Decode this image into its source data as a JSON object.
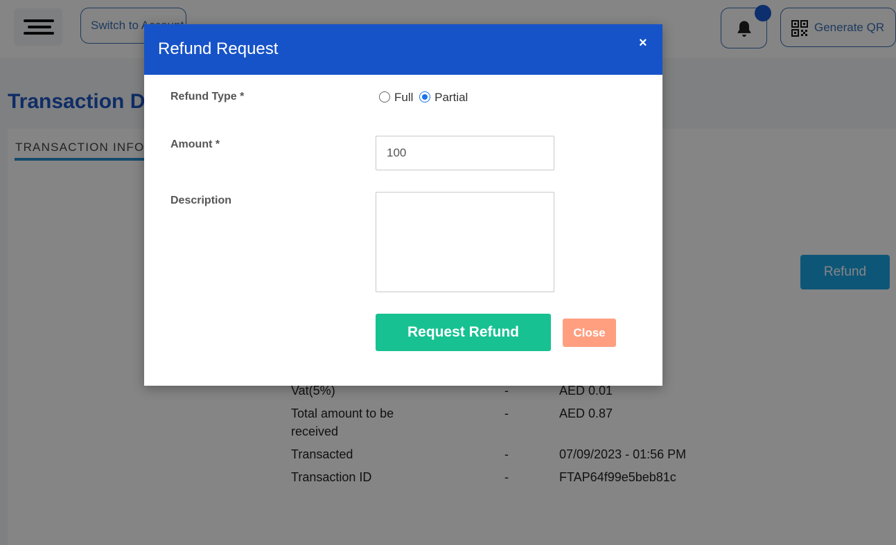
{
  "header": {
    "switch_label": "Switch to Account",
    "generate_qr_label": "Generate QR"
  },
  "page": {
    "title": "Transaction Details",
    "tab_label": "TRANSACTION INFO",
    "refund_button_label": "Refund"
  },
  "details": [
    {
      "label": "Vat(5%)",
      "value": "AED 0.01"
    },
    {
      "label": "Total amount to be received",
      "value": "AED 0.87"
    },
    {
      "label": "Transacted",
      "value": "07/09/2023 - 01:56 PM"
    },
    {
      "label": "Transaction ID",
      "value": "FTAP64f99e5beb81c"
    }
  ],
  "separator": "-",
  "modal": {
    "title": "Refund Request",
    "close_icon": "×",
    "refund_type_label": "Refund Type *",
    "refund_options": [
      {
        "label": "Full",
        "checked": false
      },
      {
        "label": "Partial",
        "checked": true
      }
    ],
    "amount_label": "Amount *",
    "amount_value": "100",
    "description_label": "Description",
    "description_value": "",
    "request_button_label": "Request Refund",
    "close_button_label": "Close"
  },
  "colors": {
    "modal_header": "#1753c8",
    "request_button": "#17c192",
    "close_button": "#ff9f80",
    "page_title": "#1d56c4",
    "refund_button": "#1ca6e6"
  }
}
